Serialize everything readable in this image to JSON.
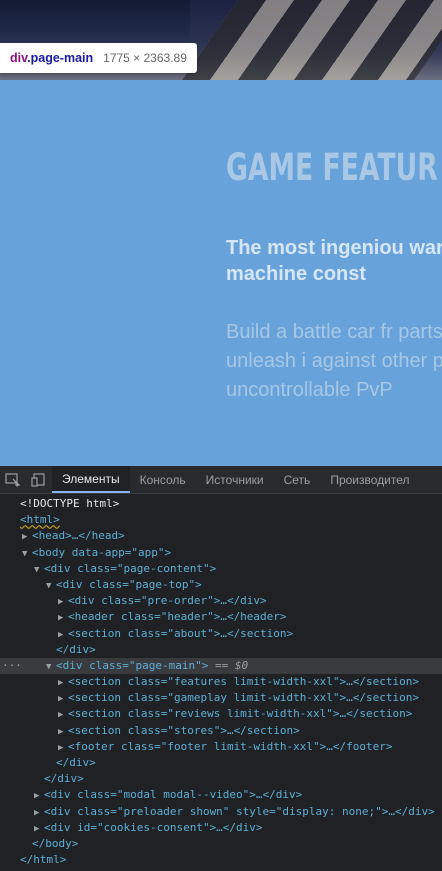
{
  "tooltip": {
    "tag": "div",
    "class": ".page-main",
    "size": "1775 × 2363.89"
  },
  "page": {
    "title": "GAME FEATUR",
    "subtitle": "The most ingeniou war machine const",
    "body": "Build a battle car fr parts and unleash i against other playe uncontrollable PvP"
  },
  "devtools": {
    "tabs": [
      "Элементы",
      "Консоль",
      "Источники",
      "Сеть",
      "Производител"
    ],
    "active_tab": "Элементы",
    "selected_suffix": "== $0",
    "dom_lines": [
      "<!DOCTYPE html>",
      "<html>",
      "<head>…</head>",
      "<body data-app=\"app\">",
      "<div class=\"page-content\">",
      "<div class=\"page-top\">",
      "<div class=\"pre-order\">…</div>",
      "<header class=\"header\">…</header>",
      "<section class=\"about\">…</section>",
      "</div>",
      "<div class=\"page-main\">",
      "<section class=\"features limit-width-xxl\">…</section>",
      "<section class=\"gameplay limit-width-xxl\">…</section>",
      "<section class=\"reviews limit-width-xxl\">…</section>",
      "<section class=\"stores\">…</section>",
      "<footer class=\"footer limit-width-xxl\">…</footer>",
      "</div>",
      "</div>",
      "<div class=\"modal modal--video\">…</div>",
      "<div class=\"preloader shown\" style=\"display: none;\">…</div>",
      "<div id=\"cookies-consent\">…</div>",
      "</body>",
      "</html>"
    ]
  },
  "icons": [
    "inspect-icon",
    "device-toggle-icon",
    "collapse-triangle-icon",
    "expand-triangle-icon"
  ]
}
